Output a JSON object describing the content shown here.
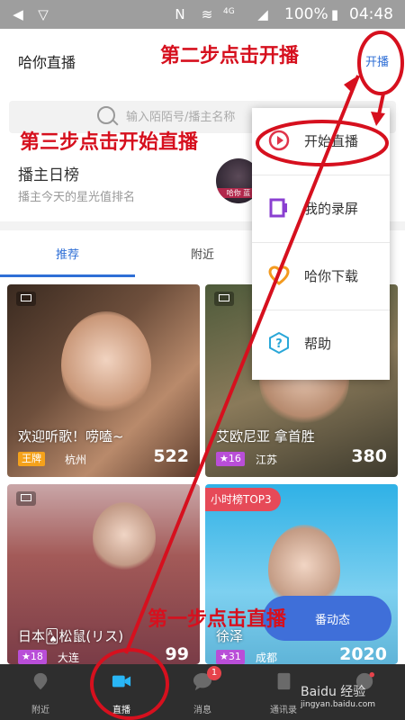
{
  "status_bar": {
    "battery": "100%",
    "time": "04:48",
    "network": "4G"
  },
  "header": {
    "title": "哈你直播",
    "start_live": "开播"
  },
  "search": {
    "placeholder": "输入陌陌号/播主名称"
  },
  "ranking": {
    "title": "播主日榜",
    "subtitle": "播主今天的星光值排名",
    "avatar_text": "哈你 蓝"
  },
  "tabs": {
    "recommended": "推荐",
    "nearby": "附近"
  },
  "cards": [
    {
      "title": "欢迎听歌！唠嗑~",
      "badge": "王牌",
      "location": "杭州",
      "count": "522"
    },
    {
      "title": "艾欧尼亚 拿首胜",
      "badge": "16",
      "location": "江苏",
      "count": "380"
    },
    {
      "title": "日本🂡松鼠(リス)",
      "badge": "18",
      "location": "大连",
      "count": "99"
    },
    {
      "title": "徐泽",
      "badge": "31",
      "location": "成都",
      "count": "2020",
      "tag": "小时榜TOP3"
    }
  ],
  "feed_button": {
    "label": "番动态"
  },
  "popup": {
    "items": [
      {
        "label": "开始直播",
        "icon": "play-circle-icon"
      },
      {
        "label": "我的录屏",
        "icon": "screen-record-icon"
      },
      {
        "label": "哈你下载",
        "icon": "heart-download-icon"
      },
      {
        "label": "帮助",
        "icon": "help-icon"
      }
    ]
  },
  "bottom_nav": {
    "items": [
      {
        "label": "附近",
        "icon": "location-icon"
      },
      {
        "label": "直播",
        "icon": "video-camera-icon"
      },
      {
        "label": "消息",
        "icon": "chat-bubble-icon",
        "badge": "1"
      },
      {
        "label": "通讯录",
        "icon": "contacts-icon"
      },
      {
        "label": "",
        "icon": "profile-icon"
      }
    ]
  },
  "annotations": {
    "step1": "第一步点击直播",
    "step2": "第二步点击开播",
    "step3": "第三步点击开始直播"
  },
  "watermark": {
    "brand": "Baidu 经验",
    "url": "jingyan.baidu.com"
  },
  "colors": {
    "accent": "#2f6fd6",
    "annotation": "#d6101e",
    "nav_bg": "#2e2e2e"
  }
}
